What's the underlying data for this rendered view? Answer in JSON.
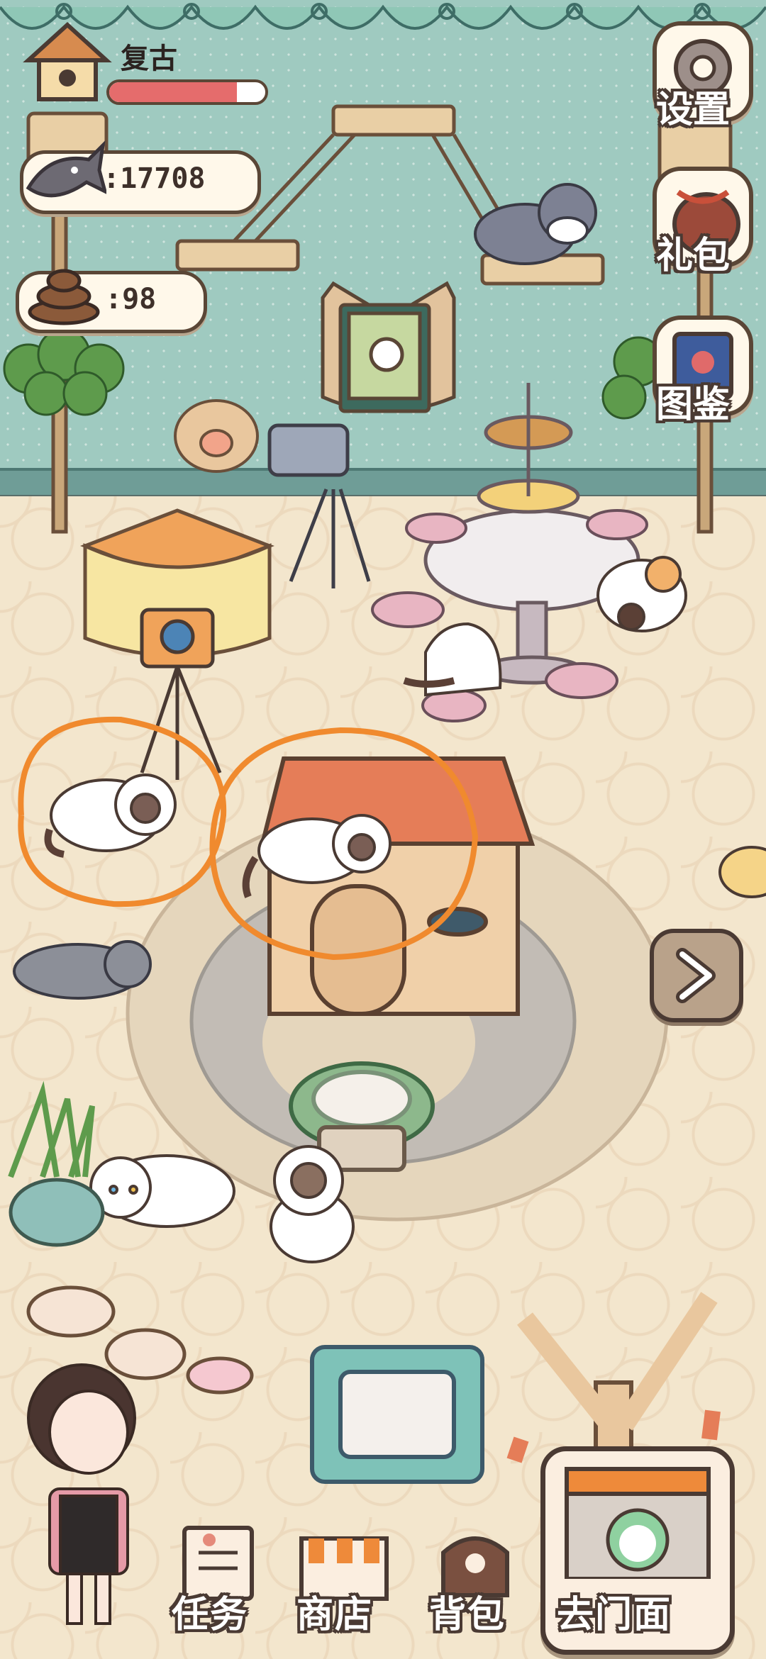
{
  "hud": {
    "level_name": "复古",
    "level_progress": 0.82,
    "fish_value": ":17708",
    "poop_value": ":98",
    "colors": {
      "progress_fill": "#e56c6c",
      "hud_border": "#5a4636"
    }
  },
  "side_buttons": [
    {
      "label": "设置",
      "icon": "gear-icon"
    },
    {
      "label": "礼包",
      "icon": "gift-bag-icon"
    },
    {
      "label": "图鉴",
      "icon": "book-icon"
    }
  ],
  "bottom_nav": [
    {
      "label": "任务",
      "icon": "task-paper-icon"
    },
    {
      "label": "商店",
      "icon": "shop-awning-icon"
    },
    {
      "label": "背包",
      "icon": "backpack-icon"
    },
    {
      "label": "去门面",
      "icon": "storefront-icon"
    }
  ],
  "next_button": {
    "icon": "chevron-right-icon"
  },
  "annotations": {
    "circle_color": "#f08a2e"
  }
}
